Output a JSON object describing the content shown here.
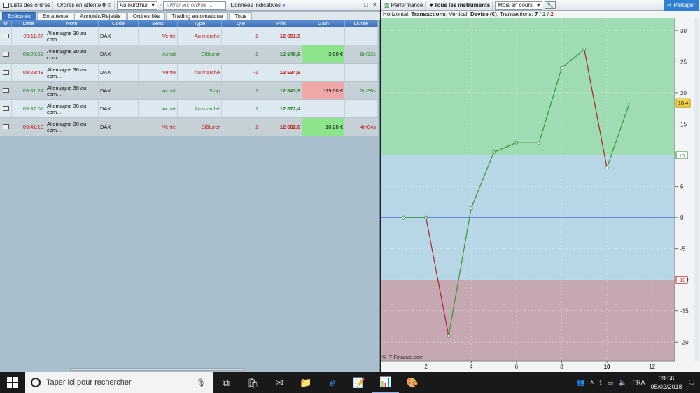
{
  "left": {
    "toolbar": {
      "orders_list": "Liste des ordres",
      "pending_orders": "Ordres en attente",
      "pending_count": "0",
      "period": "Aujourd'hui",
      "filter_placeholder": "Filtrer les ordres ...",
      "indicative": "Données indicatives"
    },
    "tabs": [
      "Exécutés",
      "En attente",
      "Annulés/Rejetés",
      "Ordres liés",
      "Trading automatique",
      "Tous"
    ],
    "columns": [
      "Date",
      "Nom",
      "Code",
      "Sens",
      "Type",
      "Qté",
      "Prix",
      "Gain",
      "Durée"
    ],
    "rows": [
      {
        "date": "09:11:27",
        "nom": "Allemagne 30 au com...",
        "code": "DAX",
        "sens": "Vente",
        "type": "Au marché",
        "qte": "-1",
        "prix": "12 651,9",
        "gain": "",
        "duree": "",
        "dir": "red",
        "gainStyle": ""
      },
      {
        "date": "09:20:59",
        "nom": "Allemagne 30 au com...",
        "code": "DAX",
        "sens": "Achat",
        "type": "Clôturer",
        "qte": "1",
        "prix": "12 648,9",
        "gain": "3,00 €",
        "duree": "9m32s",
        "dir": "green",
        "gainStyle": "pos"
      },
      {
        "date": "09:28:48",
        "nom": "Allemagne 30 au com...",
        "code": "DAX",
        "sens": "Vente",
        "type": "Au marché",
        "qte": "-1",
        "prix": "12 624,9",
        "gain": "",
        "duree": "",
        "dir": "red",
        "gainStyle": ""
      },
      {
        "date": "09:31:24",
        "nom": "Allemagne 30 au com...",
        "code": "DAX",
        "sens": "Achat",
        "type": "Stop",
        "qte": "1",
        "prix": "12 643,9",
        "gain": "-19,00 €",
        "duree": "2m36s",
        "dir": "green",
        "gainStyle": "neg"
      },
      {
        "date": "09:37:07",
        "nom": "Allemagne 30 au com...",
        "code": "DAX",
        "sens": "Achat",
        "type": "Au marché",
        "qte": "1",
        "prix": "12 672,4",
        "gain": "",
        "duree": "",
        "dir": "green",
        "gainStyle": ""
      },
      {
        "date": "09:41:10",
        "nom": "Allemagne 30 au com...",
        "code": "DAX",
        "sens": "Vente",
        "type": "Clôturer",
        "qte": "-1",
        "prix": "12 682,6",
        "gain": "10,20 €",
        "duree": "4m04s",
        "dir": "red",
        "gainStyle": "pos"
      }
    ]
  },
  "right": {
    "toolbar": {
      "performance": "Performance",
      "instruments": "Tous les instruments",
      "period": "Mois en cours",
      "share": "Partager"
    },
    "info": {
      "horizontal_label": "Horizontal: ",
      "horizontal_value": "Transactions",
      "vertical_label": ", Vertical: ",
      "vertical_value": "Devise (€)",
      "transactions_label": ", Transactions: ",
      "t_total": "7",
      "t_win": "2",
      "t_loss": "2"
    },
    "watermark": "© IT-Finance.com",
    "current_value_label": "18,4"
  },
  "chart_data": {
    "type": "line",
    "x": [
      1,
      2,
      3,
      4,
      5,
      6,
      7,
      8,
      9,
      10,
      11
    ],
    "values": [
      0,
      0,
      -19,
      1.5,
      10.5,
      12,
      12,
      24,
      27,
      8,
      18.4
    ],
    "segment_colors": [
      "green",
      "red",
      "green",
      "green",
      "green",
      "green",
      "green",
      "green",
      "red",
      "green"
    ],
    "xlim": [
      0,
      13
    ],
    "ylim": [
      -23,
      32
    ],
    "xticks": [
      2,
      4,
      6,
      8,
      10,
      12
    ],
    "yticks": [
      30,
      25,
      20,
      15,
      10,
      5,
      0,
      -5,
      -10,
      -15,
      -20
    ],
    "band_upper": 10,
    "band_lower": -10,
    "band_colors": {
      "profit": "#9fdcb4",
      "neutral": "#b7d6e6",
      "loss": "#c5a8b2"
    },
    "zero_line_color": "#4a6ee0"
  },
  "taskbar": {
    "search_placeholder": "Taper ici pour rechercher",
    "lang": "FRA",
    "time": "09:56",
    "date": "05/02/2018"
  }
}
